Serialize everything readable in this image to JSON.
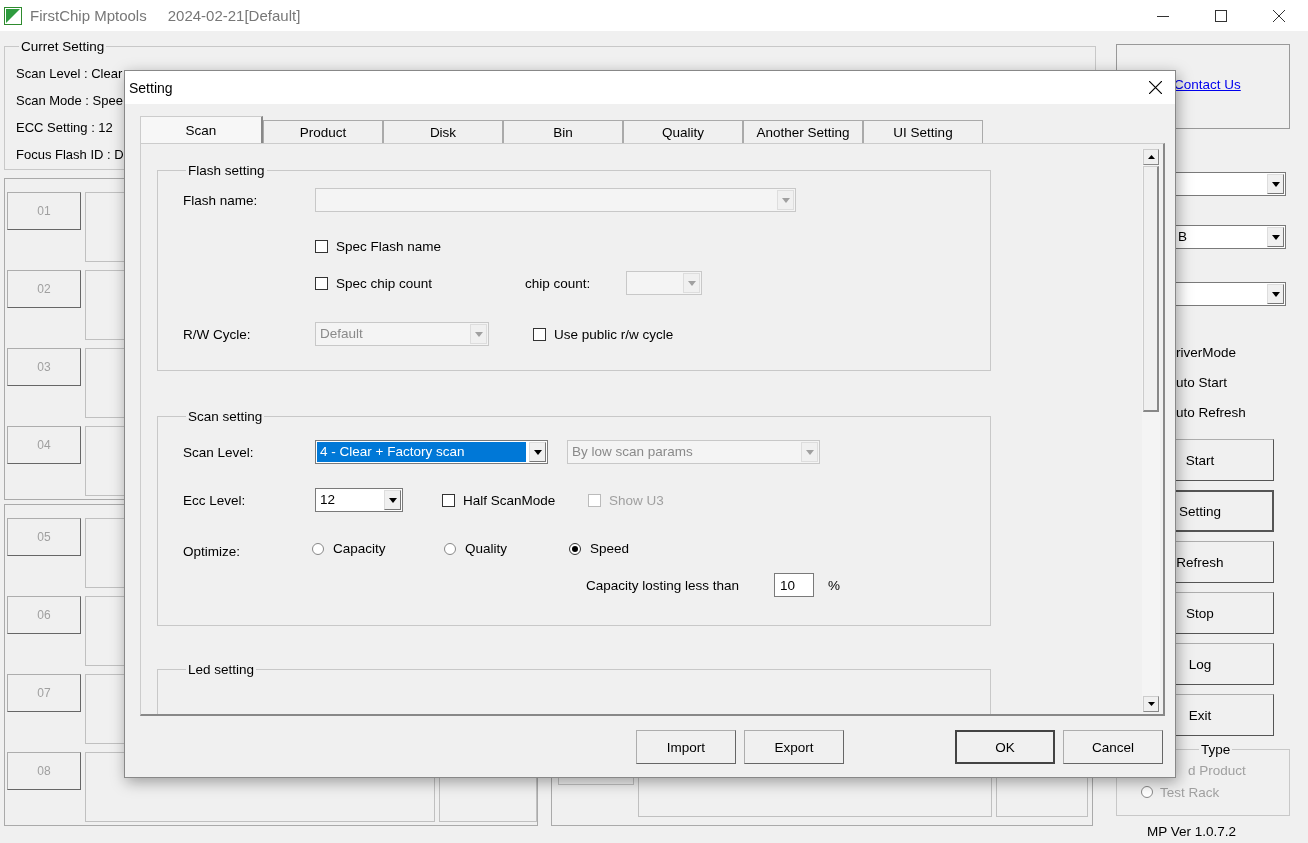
{
  "window": {
    "title": "FirstChip Mptools",
    "build": "2024-02-21[Default]"
  },
  "current_setting": {
    "title": "Curret Setting",
    "lines": [
      "Scan Level : Clear",
      "Scan Mode : Spee",
      "ECC Setting : 12",
      "Focus Flash ID : D"
    ]
  },
  "slots": [
    {
      "label": "01",
      "disabled": true
    },
    {
      "label": "02",
      "disabled": true
    },
    {
      "label": "03",
      "disabled": true
    },
    {
      "label": "04",
      "disabled": true
    },
    {
      "label": "05",
      "disabled": true
    },
    {
      "label": "06",
      "disabled": true
    },
    {
      "label": "07",
      "disabled": true
    },
    {
      "label": "08",
      "disabled": true
    }
  ],
  "side_panel": {
    "link": "Contact Us",
    "dropdowns": [
      {
        "disabled": false
      },
      {
        "value": "B",
        "disabled": false
      },
      {
        "disabled": false
      }
    ],
    "options": [
      {
        "label": "riverMode"
      },
      {
        "label": "uto Start"
      },
      {
        "label": "uto Refresh"
      }
    ],
    "buttons": [
      {
        "label": "Start",
        "focused": false
      },
      {
        "label": "Setting",
        "focused": true
      },
      {
        "label": "Refresh",
        "focused": false
      },
      {
        "label": "Stop",
        "focused": false
      },
      {
        "label": "Log",
        "focused": false
      },
      {
        "label": "Exit",
        "focused": false
      }
    ],
    "type_group": {
      "title": "Type",
      "items": [
        {
          "label": "d Product",
          "disabled": true
        },
        {
          "label": "Test Rack",
          "disabled": true,
          "selected": false
        }
      ]
    },
    "version": "MP Ver 1.0.7.2"
  },
  "dialog": {
    "title": "Setting",
    "tabs": [
      {
        "label": "Scan",
        "selected": true
      },
      {
        "label": "Product",
        "selected": false
      },
      {
        "label": "Disk",
        "selected": false
      },
      {
        "label": "Bin",
        "selected": false
      },
      {
        "label": "Quality",
        "selected": false
      },
      {
        "label": "Another Setting",
        "selected": false
      },
      {
        "label": "UI Setting",
        "selected": false
      }
    ],
    "flash_setting": {
      "title": "Flash setting",
      "flash_name_label": "Flash name:",
      "flash_name": {
        "disabled": true
      },
      "spec_flash_name": {
        "label": "Spec Flash name",
        "checked": false
      },
      "spec_chip_count": {
        "label": "Spec chip count",
        "checked": false
      },
      "chip_count_label": "chip count:",
      "chip_count": {
        "disabled": true
      },
      "rw_cycle_label": "R/W Cycle:",
      "rw_cycle": {
        "value": "Default",
        "disabled": true
      },
      "use_public_rw": {
        "label": "Use public r/w cycle",
        "checked": false
      }
    },
    "scan_setting": {
      "title": "Scan setting",
      "scan_level_label": "Scan Level:",
      "scan_level": {
        "value": "4 - Clear + Factory scan",
        "disabled": false,
        "selected": true
      },
      "scan_params": {
        "value": "By low scan params",
        "disabled": true
      },
      "ecc_level_label": "Ecc Level:",
      "ecc_level": {
        "value": "12",
        "disabled": false
      },
      "half_scan_mode": {
        "label": "Half ScanMode",
        "checked": false,
        "disabled": false
      },
      "show_u3": {
        "label": "Show U3",
        "checked": false,
        "disabled": true
      },
      "optimize_label": "Optimize:",
      "optimize": [
        {
          "label": "Capacity",
          "selected": false
        },
        {
          "label": "Quality",
          "selected": false
        },
        {
          "label": "Speed",
          "selected": true
        }
      ],
      "capacity_label": "Capacity losting less than",
      "capacity_value": "10",
      "capacity_unit": "%"
    },
    "led_setting": {
      "title": "Led setting"
    },
    "buttons": [
      {
        "label": "Import",
        "default": false
      },
      {
        "label": "Export",
        "default": false
      },
      {
        "label": "OK",
        "default": true
      },
      {
        "label": "Cancel",
        "default": false
      }
    ]
  }
}
